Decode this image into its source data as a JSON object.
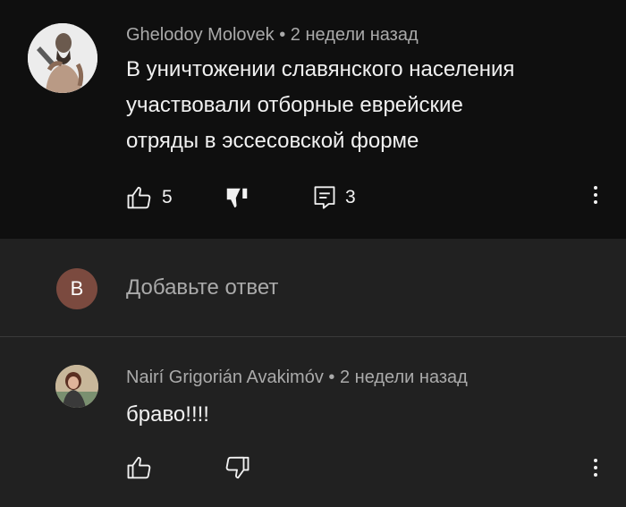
{
  "comment": {
    "author": "Ghelodoy Molovek",
    "separator": "•",
    "time": "2 недели назад",
    "text_lines": [
      "В уничтожении славянского населения",
      "участвовали отборные еврейские",
      "отряды в эссесовской форме"
    ],
    "likes": "5",
    "replies": "3"
  },
  "reply_input": {
    "avatar_letter": "B",
    "placeholder": "Добавьте ответ"
  },
  "reply": {
    "author": "Nairí Grigorián Avakimóv",
    "separator": "•",
    "time": "2 недели назад",
    "text": "браво!!!!"
  },
  "colors": {
    "top_bg": "#0f0f0f",
    "bg": "#212121",
    "avatar_letter_bg": "#7b4a3f"
  }
}
